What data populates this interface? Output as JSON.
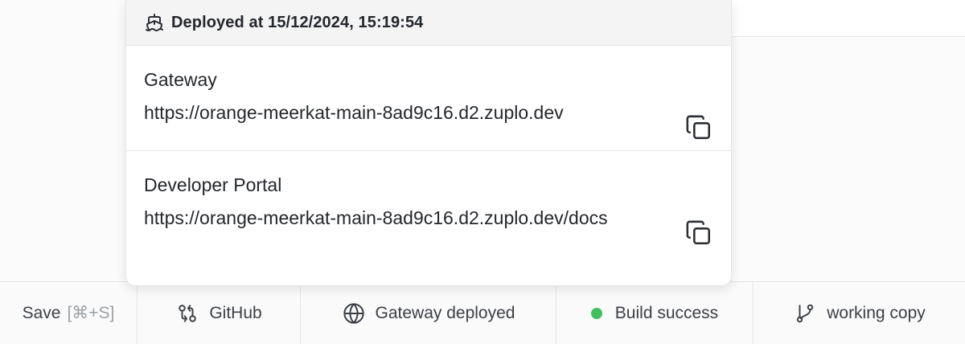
{
  "popover": {
    "header_title": "Deployed at 15/12/2024, 15:19:54",
    "header_icon": "ship-icon",
    "entries": [
      {
        "label": "Gateway",
        "url": "https://orange-meerkat-main-8ad9c16.d2.zuplo.dev",
        "action_icon": "copy-icon"
      },
      {
        "label": "Developer Portal",
        "url": "https://orange-meerkat-main-8ad9c16.d2.zuplo.dev/docs",
        "action_icon": "copy-icon"
      }
    ]
  },
  "statusbar": {
    "save_label": "Save",
    "save_shortcut": "[⌘+S]",
    "github_label": "GitHub",
    "github_icon": "git-compare-icon",
    "gateway_label": "Gateway deployed",
    "gateway_icon": "globe-icon",
    "build_label": "Build success",
    "build_status_color": "#3fbf5f",
    "branch_label": "working copy",
    "branch_icon": "git-branch-icon"
  }
}
